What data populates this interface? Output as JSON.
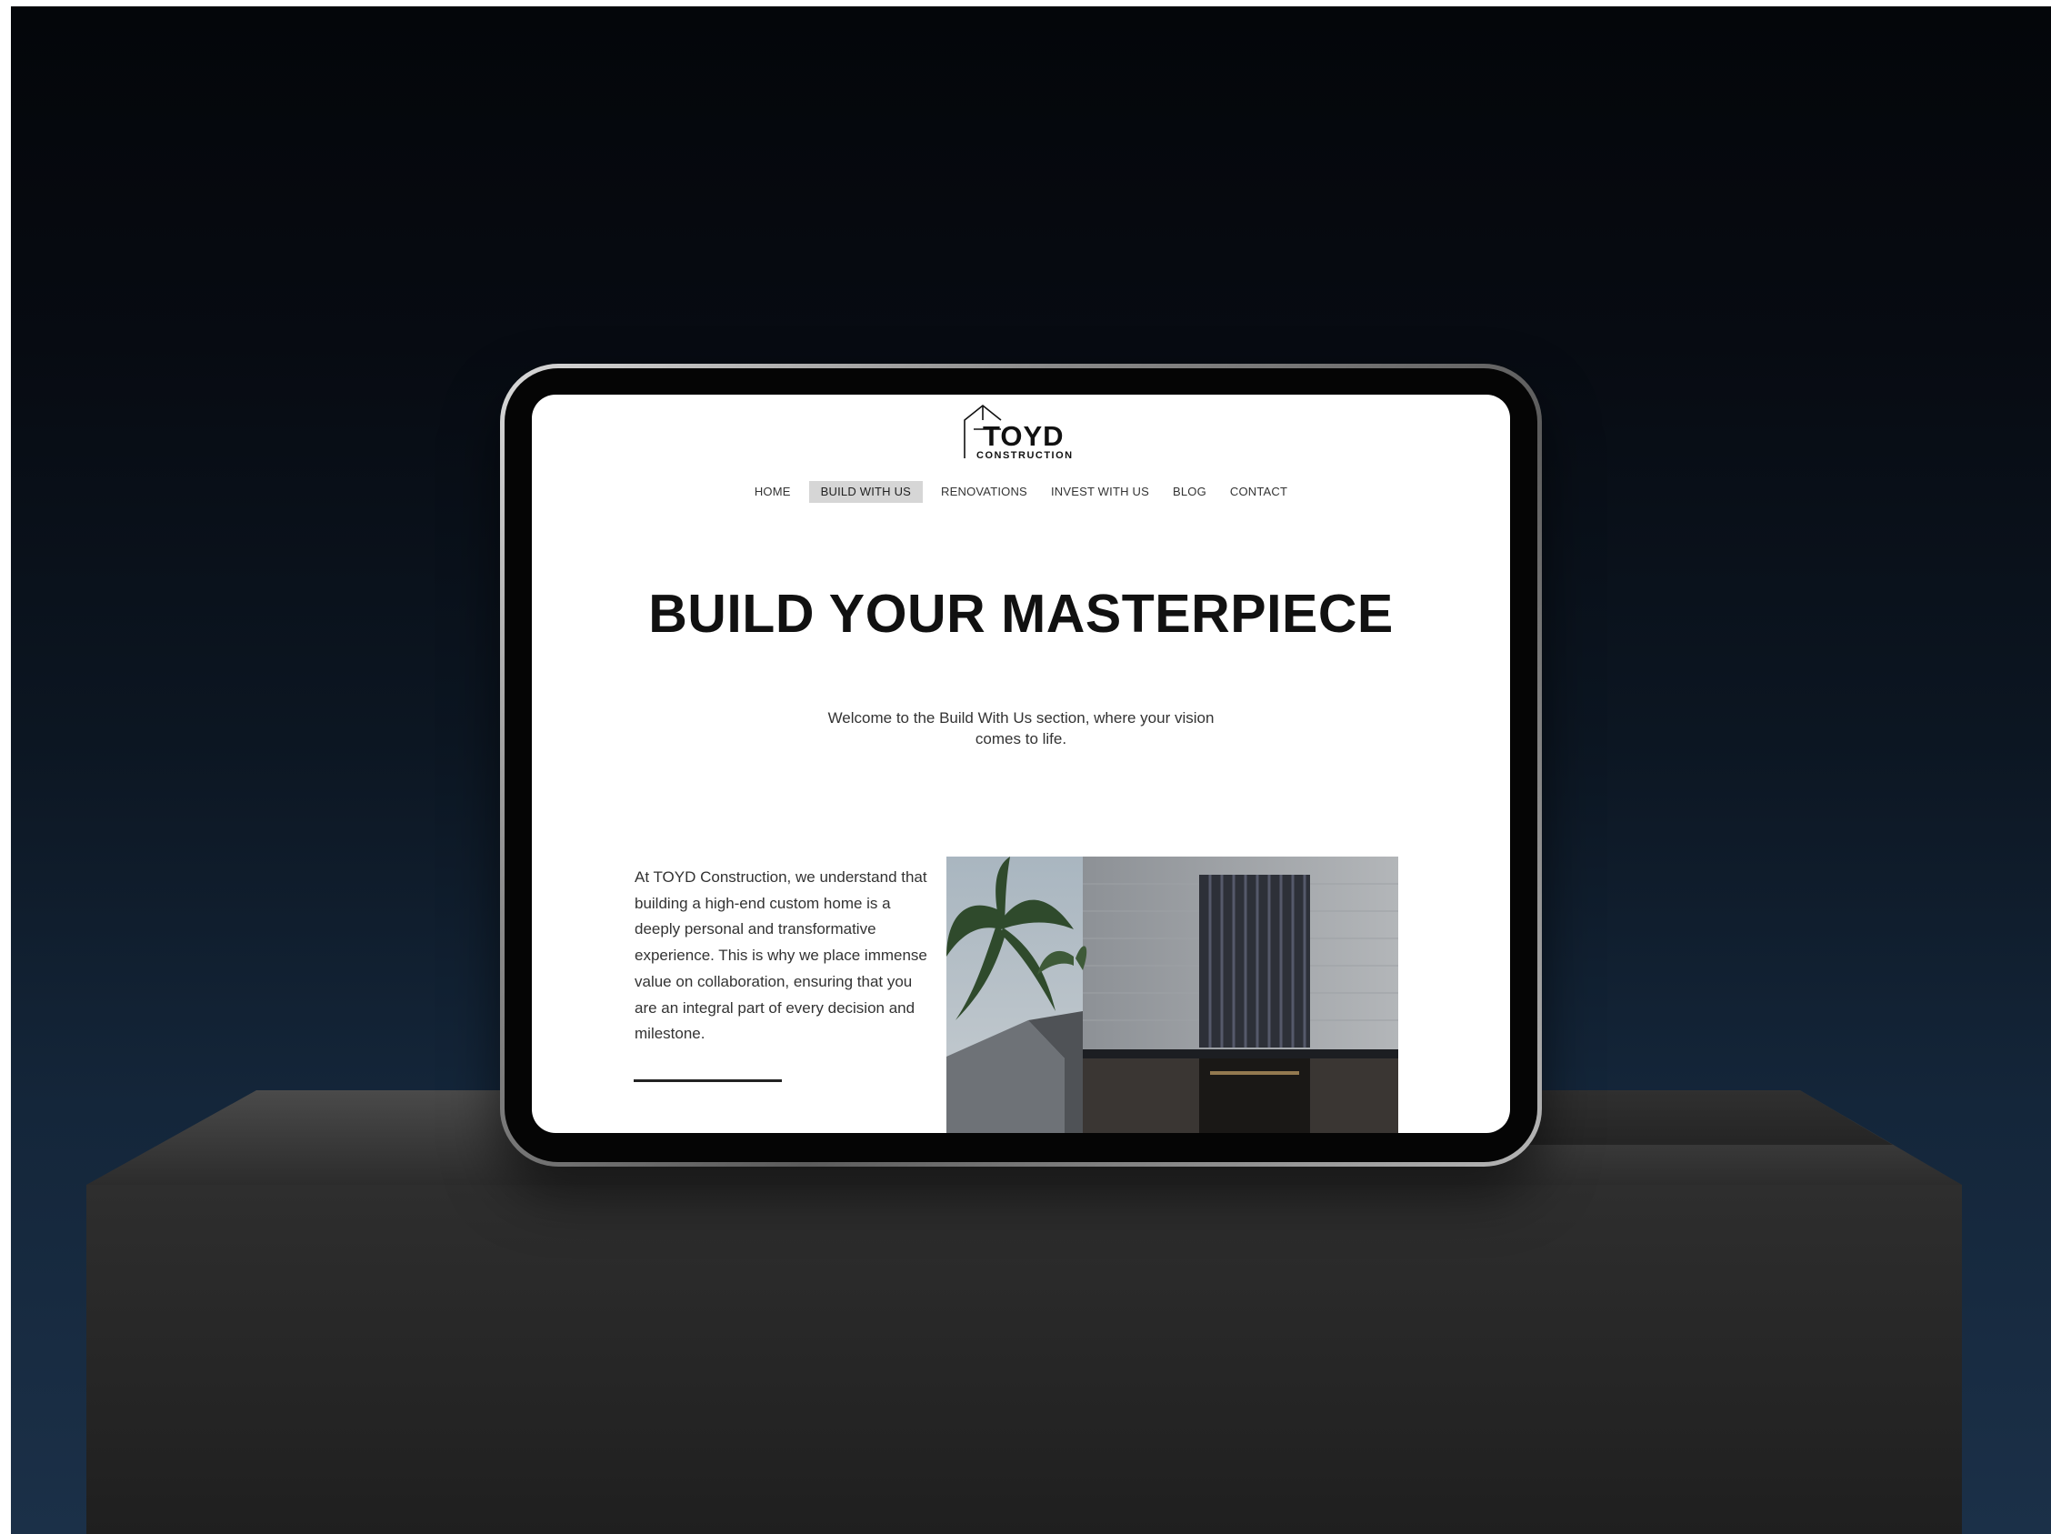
{
  "site": {
    "logo": {
      "name": "TOYD",
      "tagline": "CONSTRUCTION"
    },
    "nav": {
      "items": [
        {
          "label": "HOME"
        },
        {
          "label": "BUILD WITH US"
        },
        {
          "label": "RENOVATIONS"
        },
        {
          "label": "INVEST WITH US"
        },
        {
          "label": "BLOG"
        },
        {
          "label": "CONTACT"
        }
      ],
      "active": "BUILD WITH US"
    },
    "hero": {
      "title": "BUILD YOUR MASTERPIECE",
      "intro": "Welcome to the Build With Us section, where your vision comes to life."
    },
    "content": {
      "paragraph": "At TOYD Construction, we understand that building a high-end custom home is a deeply personal and transformative experience. This is why we place immense value on collaboration, ensuring that you are an integral part of every decision and milestone."
    }
  },
  "colors": {
    "background_top": "#04060a",
    "background_bottom": "#1b3048",
    "nav_active_bg": "#d6d6d6",
    "text_dark": "#111111"
  }
}
